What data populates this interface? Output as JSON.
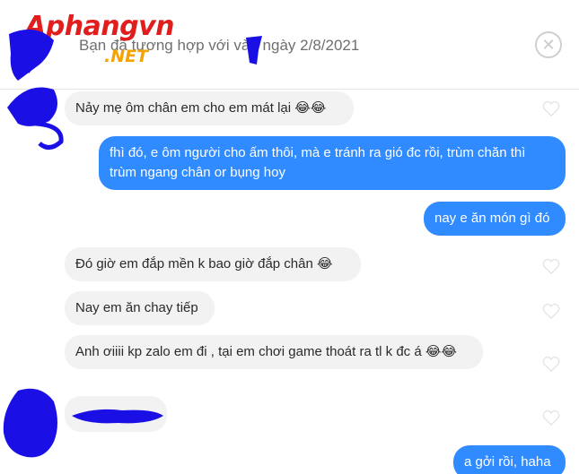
{
  "watermark": {
    "brand": "Aphangvn",
    "tld": ".NET"
  },
  "header": {
    "match_text": "Bạn đã tương hợp với      vào ngày 2/8/2021",
    "close_icon": "close-circle-icon"
  },
  "messages": [
    {
      "side": "in",
      "text": "Nảy mẹ ôm chân em cho em mát lại 😂😂"
    },
    {
      "side": "out",
      "text": "fhì đó, e ôm người cho ấm thôi, mà e tránh ra gió đc rồi, trùm chăn thì trùm ngang chân or bụng hoy"
    },
    {
      "side": "out",
      "text": "nay e ăn món gì đó"
    },
    {
      "side": "in",
      "text": "Đó giờ em đắp mền k bao giờ đắp chân 😂"
    },
    {
      "side": "in",
      "text": "Nay em ăn chay tiếp"
    },
    {
      "side": "in",
      "text": "Anh ơiiii kp zalo em đi , tại em chơi game thoát ra tl k đc á 😂😂"
    },
    {
      "side": "in",
      "text": ""
    },
    {
      "side": "out",
      "text": "a gởi rồi, haha"
    }
  ],
  "colors": {
    "outgoing": "#2f8bff",
    "incoming": "#f2f2f2",
    "redaction": "#1a10e6"
  }
}
